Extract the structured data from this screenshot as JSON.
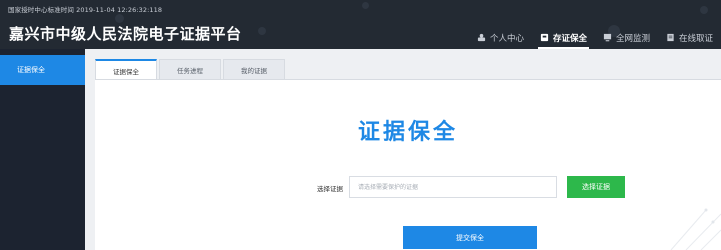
{
  "header": {
    "timestamp": "国家授时中心标准时间 2019-11-04 12:26:32:118",
    "title": "嘉兴市中级人民法院电子证据平台",
    "nav": [
      {
        "label": "个人中心",
        "icon": "user-icon"
      },
      {
        "label": "存证保全",
        "icon": "storage-icon",
        "active": true
      },
      {
        "label": "全网监测",
        "icon": "monitor-icon"
      },
      {
        "label": "在线取证",
        "icon": "document-icon"
      }
    ]
  },
  "sidebar": {
    "items": [
      {
        "label": "证据保全",
        "active": true
      }
    ]
  },
  "main": {
    "tabs": [
      {
        "label": "证据保全",
        "active": true
      },
      {
        "label": "任务进程"
      },
      {
        "label": "我的证据"
      }
    ],
    "heading": "证据保全",
    "field_label": "选择证据",
    "input_placeholder": "请选择需要保护的证据",
    "input_value": "",
    "choose_button": "选择证据",
    "submit_button": "提交保全"
  },
  "colors": {
    "header_bg": "#232a33",
    "sidebar_bg": "#1c2330",
    "accent": "#1e88e5",
    "green": "#2db84b"
  }
}
